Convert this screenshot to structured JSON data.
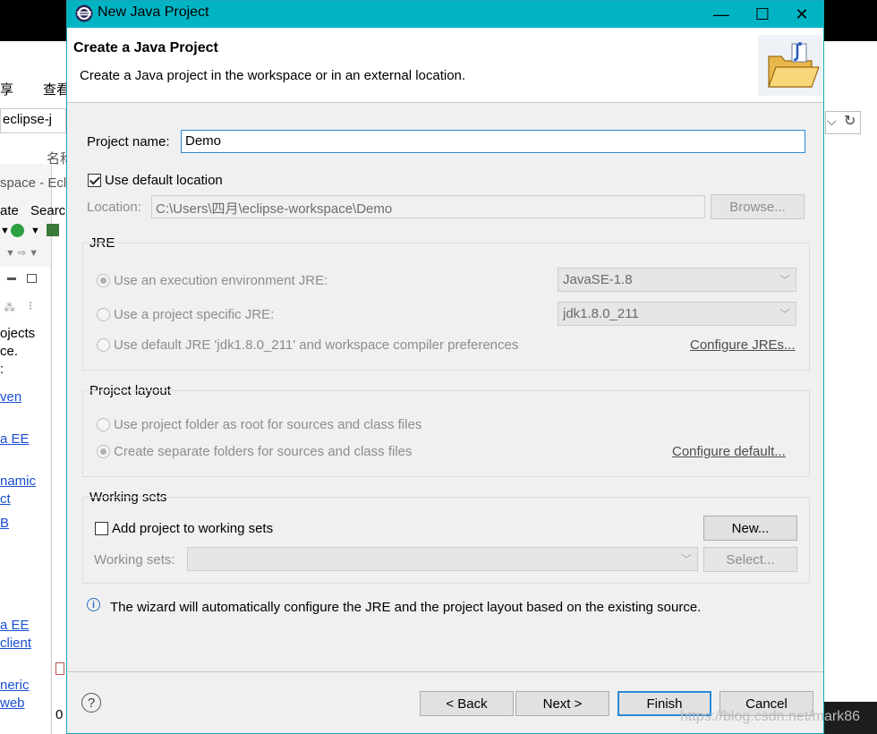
{
  "background": {
    "menu_items": [
      "享",
      "查看"
    ],
    "address_text": "eclipse-j",
    "column_header": "名称",
    "window_title_partial": "space - Ecli",
    "menu_partial": [
      "ate",
      "Searc"
    ],
    "sidebar_text": [
      "ojects",
      "ce.",
      ":"
    ],
    "sidebar_links": [
      "ven",
      "a EE",
      "namic",
      "ct",
      "B",
      "a EE",
      "client",
      "neric",
      "web"
    ],
    "bottom_text": "0"
  },
  "dialog": {
    "title": "New Java Project",
    "controls": {
      "minimize": "—",
      "maximize": "☐",
      "close": "✕"
    },
    "header": {
      "title": "Create a Java Project",
      "description": "Create a Java project in the workspace or in an external location."
    },
    "project_name": {
      "label": "Project name:",
      "value": "Demo"
    },
    "default_location": {
      "label": "Use default location",
      "checked": true
    },
    "location": {
      "label": "Location:",
      "value": "C:\\Users\\四月\\eclipse-workspace\\Demo",
      "browse": "Browse..."
    },
    "jre": {
      "title": "JRE",
      "option_env": "Use an execution environment JRE:",
      "env_value": "JavaSE-1.8",
      "option_specific": "Use a project specific JRE:",
      "specific_value": "jdk1.8.0_211",
      "option_default": "Use default JRE 'jdk1.8.0_211' and workspace compiler preferences",
      "configure_link": "Configure JREs..."
    },
    "layout": {
      "title": "Project layout",
      "option_root": "Use project folder as root for sources and class files",
      "option_separate": "Create separate folders for sources and class files",
      "configure_link": "Configure default..."
    },
    "working_sets": {
      "title": "Working sets",
      "add_label": "Add project to working sets",
      "add_checked": false,
      "new_button": "New...",
      "sets_label": "Working sets:",
      "select_button": "Select..."
    },
    "info": "The wizard will automatically configure the JRE and the project layout based on the existing source.",
    "buttons": {
      "help": "?",
      "back": "< Back",
      "next": "Next >",
      "finish": "Finish",
      "cancel": "Cancel"
    }
  },
  "watermark": "https://blog.csdn.net/mark86",
  "colors": {
    "titlebar": "#00b4c4",
    "focus": "#2c8ad7",
    "link": "#4d4d4d"
  }
}
